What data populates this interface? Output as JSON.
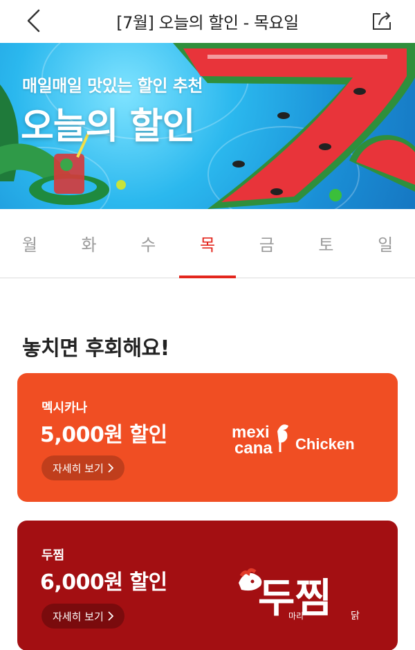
{
  "header": {
    "title": "[7월] 오늘의 할인 - 목요일",
    "back_icon": "chevron-left-icon",
    "share_icon": "share-icon"
  },
  "banner": {
    "subtitle": "매일매일 맛있는 할인 추천",
    "headline": "오늘의 할인",
    "colors": {
      "pool": "#2bb8ee",
      "watermelon": "#e8343a",
      "rind": "#2f8f3c"
    }
  },
  "tabs": [
    {
      "label": "월",
      "active": false
    },
    {
      "label": "화",
      "active": false
    },
    {
      "label": "수",
      "active": false
    },
    {
      "label": "목",
      "active": true
    },
    {
      "label": "금",
      "active": false
    },
    {
      "label": "토",
      "active": false
    },
    {
      "label": "일",
      "active": false
    }
  ],
  "section": {
    "title": "놓치면 후회해요!"
  },
  "cards": [
    {
      "brand": "멕시카나",
      "discount": "5,000원 할인",
      "detail": "자세히 보기",
      "bg": "#f04e23",
      "logo": {
        "line1": "mexi",
        "line2": "cana",
        "word": "Chicken"
      }
    },
    {
      "brand": "두찜",
      "discount": "6,000원 할인",
      "detail": "자세히 보기",
      "bg": "#a30f12",
      "logo": {
        "main": "두찜",
        "sub1": "마리",
        "sub2": "닭"
      }
    }
  ],
  "accent": "#e3261d"
}
